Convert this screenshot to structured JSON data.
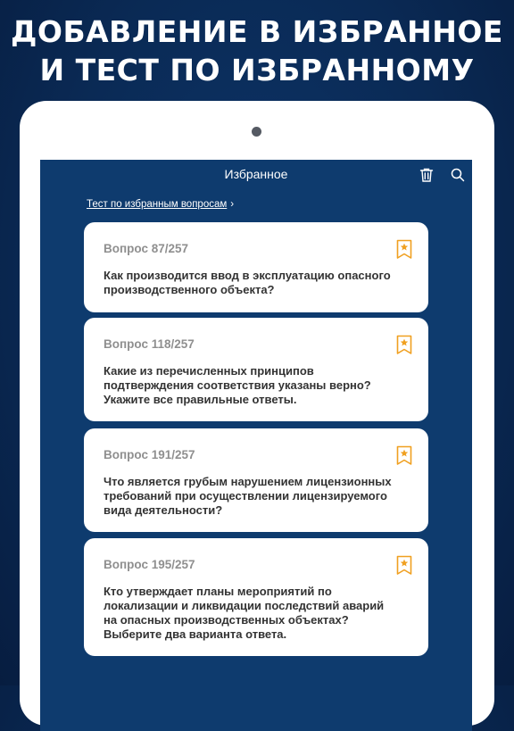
{
  "headline": {
    "line1": "ДОБАВЛЕНИЕ В ИЗБРАННОЕ",
    "line2": "И ТЕСТ ПО ИЗБРАННОМУ"
  },
  "nav": {
    "title": "Избранное",
    "icons": [
      "trash-icon",
      "search-icon"
    ]
  },
  "test_link": {
    "label": "Тест по избранным вопросам",
    "chevron": "›"
  },
  "colors": {
    "background": "#0a2a55",
    "screen": "#0e3b6e",
    "bookmark": "#f0a020",
    "card": "#ffffff"
  },
  "cards": [
    {
      "number": "Вопрос 87/257",
      "text": "Как производится ввод в эксплуатацию опасного производственного объекта?"
    },
    {
      "number": "Вопрос 118/257",
      "text": "Какие из перечисленных принципов подтверждения соответствия указаны верно? Укажите все правильные ответы."
    },
    {
      "number": "Вопрос 191/257",
      "text": "Что является грубым нарушением лицензионных требований при осуществлении лицензируемого вида деятельности?"
    },
    {
      "number": "Вопрос 195/257",
      "text": "Кто утверждает планы мероприятий по локализации и ликвидации последствий аварий на опасных производственных объектах? Выберите два варианта ответа."
    }
  ]
}
